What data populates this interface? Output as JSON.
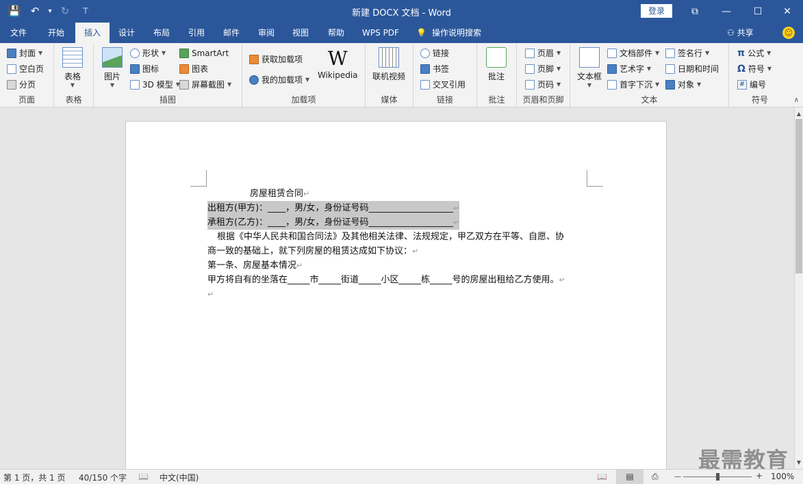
{
  "titlebar": {
    "title": "新建 DOCX 文档  -  Word",
    "login": "登录",
    "qat": {
      "save": "💾",
      "undo": "↶",
      "undo_caret": "▾",
      "redo": "↻",
      "customize": "⊤"
    },
    "win": {
      "restore": "⧉",
      "minimize": "—",
      "maximize": "☐",
      "close": "✕"
    }
  },
  "tabs": [
    "文件",
    "开始",
    "插入",
    "设计",
    "布局",
    "引用",
    "邮件",
    "审阅",
    "视图",
    "帮助",
    "WPS PDF"
  ],
  "active_tab": "插入",
  "tellme": "操作说明搜索",
  "tellme_icon": "💡",
  "share": "共享",
  "share_icon": "⚇",
  "smiley": "☺",
  "ribbon": {
    "pages": {
      "label": "页面",
      "cover": "封面",
      "blank": "空白页",
      "break": "分页"
    },
    "tables": {
      "label": "表格",
      "table": "表格"
    },
    "illustrations": {
      "label": "插图",
      "picture": "图片",
      "shapes": "形状",
      "icons": "图标",
      "model3d": "3D 模型",
      "smartart": "SmartArt",
      "chart": "图表",
      "screenshot": "屏幕截图"
    },
    "addins": {
      "label": "加载项",
      "get": "获取加载项",
      "my": "我的加载项",
      "wikipedia": "Wikipedia",
      "wiki_glyph": "W"
    },
    "media": {
      "label": "媒体",
      "video": "联机视频"
    },
    "links": {
      "label": "链接",
      "link": "链接",
      "bookmark": "书签",
      "crossref": "交叉引用"
    },
    "comments": {
      "label": "批注",
      "comment": "批注"
    },
    "headerfooter": {
      "label": "页眉和页脚",
      "header": "页眉",
      "footer": "页脚",
      "pagenum": "页码"
    },
    "text": {
      "label": "文本",
      "textbox": "文本框",
      "parts": "文档部件",
      "wordart": "艺术字",
      "dropcap": "首字下沉",
      "signature": "签名行",
      "datetime": "日期和时间",
      "object": "对象"
    },
    "symbols": {
      "label": "符号",
      "equation": "公式",
      "symbol": "符号",
      "number": "编号",
      "pi": "π",
      "omega": "Ω",
      "hash": "#"
    },
    "collapse": "∧"
  },
  "document": {
    "title": "房屋租赁合同",
    "lessor": "出租方(甲方)：____，男/女，身份证号码___________________",
    "lessee": "承租方(乙方)：____，男/女，身份证号码___________________",
    "intro1": "根据《中华人民共和国合同法》及其他相关法律、法规规定，甲乙双方在平等、自愿、协",
    "intro2": "商一致的基础上，就下列房屋的租赁达成如下协议：",
    "article1": "第一条、房屋基本情况",
    "clause1": "甲方将自有的坐落在_____市_____街道_____小区_____栋_____号的房屋出租给乙方使用。",
    "para_mark": "↵"
  },
  "watermark": "最需教育",
  "status": {
    "page": "第 1 页，共 1 页",
    "words": "40/150 个字",
    "lang": "中文(中国)",
    "zoom": "100%",
    "zoom_minus": "—",
    "zoom_plus": "+",
    "proof_icon": "📖",
    "views": {
      "read": "📖",
      "print": "▤",
      "web": "⎙"
    }
  },
  "scroll": {
    "up": "▲",
    "down": "▼"
  }
}
